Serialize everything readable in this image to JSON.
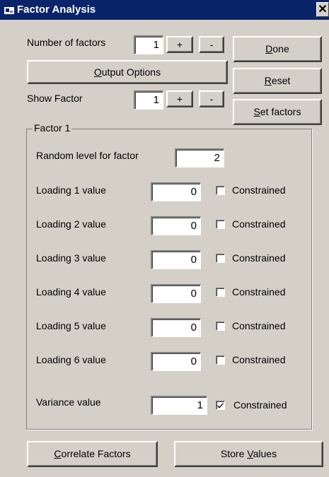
{
  "window": {
    "title": "Factor Analysis",
    "close_symbol": "✕"
  },
  "num_factors": {
    "label": "Number of factors",
    "value": "1",
    "plus": "+",
    "minus": "-"
  },
  "show_factor": {
    "label": "Show Factor",
    "value": "1",
    "plus": "+",
    "minus": "-"
  },
  "buttons": {
    "output_options": {
      "accel": "O",
      "rest": "utput Options"
    },
    "done": {
      "accel": "D",
      "rest": "one"
    },
    "reset": {
      "accel": "R",
      "rest": "eset"
    },
    "set_factors": {
      "accel": "S",
      "rest": "et factors"
    },
    "correlate_factors": {
      "accel": "C",
      "rest": "orrelate Factors"
    },
    "store_values": {
      "pre": "Store ",
      "accel": "V",
      "rest": "alues"
    }
  },
  "factor_group": {
    "legend": "Factor 1",
    "random_level": {
      "label": "Random level for factor",
      "value": "2"
    },
    "loadings": [
      {
        "label": "Loading 1 value",
        "value": "0",
        "constrained_label": "Constrained",
        "constrained": false
      },
      {
        "label": "Loading 2 value",
        "value": "0",
        "constrained_label": "Constrained",
        "constrained": false
      },
      {
        "label": "Loading 3 value",
        "value": "0",
        "constrained_label": "Constrained",
        "constrained": false
      },
      {
        "label": "Loading 4 value",
        "value": "0",
        "constrained_label": "Constrained",
        "constrained": false
      },
      {
        "label": "Loading 5 value",
        "value": "0",
        "constrained_label": "Constrained",
        "constrained": false
      },
      {
        "label": "Loading 6 value",
        "value": "0",
        "constrained_label": "Constrained",
        "constrained": false
      }
    ],
    "variance": {
      "label": "Variance value",
      "value": "1",
      "constrained_label": "Constrained",
      "constrained": true
    }
  }
}
